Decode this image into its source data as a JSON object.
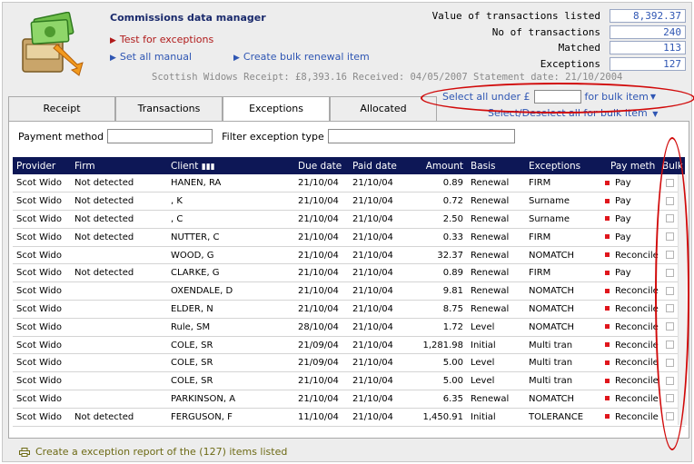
{
  "app": {
    "title": "Commissions data manager",
    "source_line": "Scottish Widows Receipt: £8,393.16  Received: 04/05/2007 Statement date: 21/10/2004"
  },
  "actions": {
    "test_exceptions": "Test for exceptions",
    "set_all_manual": "Set all manual",
    "create_bulk_renewal": "Create bulk renewal item"
  },
  "stats": [
    {
      "label": "Value of transactions listed",
      "value": "8,392.37"
    },
    {
      "label": "No of transactions",
      "value": "240"
    },
    {
      "label": "Matched",
      "value": "113"
    },
    {
      "label": "Exceptions",
      "value": "127"
    }
  ],
  "tabs": [
    "Receipt",
    "Transactions",
    "Exceptions",
    "Allocated"
  ],
  "active_tab": "Exceptions",
  "bulk": {
    "select_prefix": "Select all under £",
    "select_suffix": "for bulk item",
    "select_value": "",
    "toggle_label": "Select/Deselect all for bulk item"
  },
  "filters": {
    "payment_method_label": "Payment method",
    "payment_method_value": "",
    "exception_type_label": "Filter exception type",
    "exception_type_value": ""
  },
  "table": {
    "columns": [
      "Provider",
      "Firm",
      "Client",
      "Due date",
      "Paid date",
      "Amount",
      "Basis",
      "Exceptions",
      "Pay meth",
      "Bulk"
    ],
    "rows": [
      {
        "provider": "Scot Wido",
        "firm": "Not detected",
        "client": "HANEN, RA",
        "due": "21/10/04",
        "paid": "21/10/04",
        "amount": "0.89",
        "basis": "Renewal",
        "exception": "FIRM",
        "paymeth": "Pay"
      },
      {
        "provider": "Scot Wido",
        "firm": "Not detected",
        "client": ", K",
        "due": "21/10/04",
        "paid": "21/10/04",
        "amount": "0.72",
        "basis": "Renewal",
        "exception": "Surname",
        "paymeth": "Pay"
      },
      {
        "provider": "Scot Wido",
        "firm": "Not detected",
        "client": ", C",
        "due": "21/10/04",
        "paid": "21/10/04",
        "amount": "2.50",
        "basis": "Renewal",
        "exception": "Surname",
        "paymeth": "Pay"
      },
      {
        "provider": "Scot Wido",
        "firm": "Not detected",
        "client": "NUTTER, C",
        "due": "21/10/04",
        "paid": "21/10/04",
        "amount": "0.33",
        "basis": "Renewal",
        "exception": "FIRM",
        "paymeth": "Pay"
      },
      {
        "provider": "Scot Wido",
        "firm": "",
        "client": "WOOD, G",
        "due": "21/10/04",
        "paid": "21/10/04",
        "amount": "32.37",
        "basis": "Renewal",
        "exception": "NOMATCH",
        "paymeth": "Reconcile"
      },
      {
        "provider": "Scot Wido",
        "firm": "Not detected",
        "client": "CLARKE, G",
        "due": "21/10/04",
        "paid": "21/10/04",
        "amount": "0.89",
        "basis": "Renewal",
        "exception": "FIRM",
        "paymeth": "Pay"
      },
      {
        "provider": "Scot Wido",
        "firm": "",
        "client": "OXENDALE, D",
        "due": "21/10/04",
        "paid": "21/10/04",
        "amount": "9.81",
        "basis": "Renewal",
        "exception": "NOMATCH",
        "paymeth": "Reconcile"
      },
      {
        "provider": "Scot Wido",
        "firm": "",
        "client": "ELDER, N",
        "due": "21/10/04",
        "paid": "21/10/04",
        "amount": "8.75",
        "basis": "Renewal",
        "exception": "NOMATCH",
        "paymeth": "Reconcile"
      },
      {
        "provider": "Scot Wido",
        "firm": "",
        "client": "Rule, SM",
        "due": "28/10/04",
        "paid": "21/10/04",
        "amount": "1.72",
        "basis": "Level",
        "exception": "NOMATCH",
        "paymeth": "Reconcile"
      },
      {
        "provider": "Scot Wido",
        "firm": "",
        "client": "COLE, SR",
        "due": "21/09/04",
        "paid": "21/10/04",
        "amount": "1,281.98",
        "basis": "Initial",
        "exception": "Multi tran",
        "paymeth": "Reconcile"
      },
      {
        "provider": "Scot Wido",
        "firm": "",
        "client": "COLE, SR",
        "due": "21/09/04",
        "paid": "21/10/04",
        "amount": "5.00",
        "basis": "Level",
        "exception": "Multi tran",
        "paymeth": "Reconcile"
      },
      {
        "provider": "Scot Wido",
        "firm": "",
        "client": "COLE, SR",
        "due": "21/10/04",
        "paid": "21/10/04",
        "amount": "5.00",
        "basis": "Level",
        "exception": "Multi tran",
        "paymeth": "Reconcile"
      },
      {
        "provider": "Scot Wido",
        "firm": "",
        "client": "PARKINSON, A",
        "due": "21/10/04",
        "paid": "21/10/04",
        "amount": "6.35",
        "basis": "Renewal",
        "exception": "NOMATCH",
        "paymeth": "Reconcile"
      },
      {
        "provider": "Scot Wido",
        "firm": "Not detected",
        "client": "FERGUSON, F",
        "due": "11/10/04",
        "paid": "21/10/04",
        "amount": "1,450.91",
        "basis": "Initial",
        "exception": "TOLERANCE",
        "paymeth": "Reconcile"
      }
    ]
  },
  "footer": {
    "report_link": "Create a exception report of the (127) items listed"
  },
  "colors": {
    "header_bg": "#0d1756",
    "link": "#2f56b3",
    "alert_red": "#d10a0a",
    "footer_link": "#6d6a15"
  }
}
